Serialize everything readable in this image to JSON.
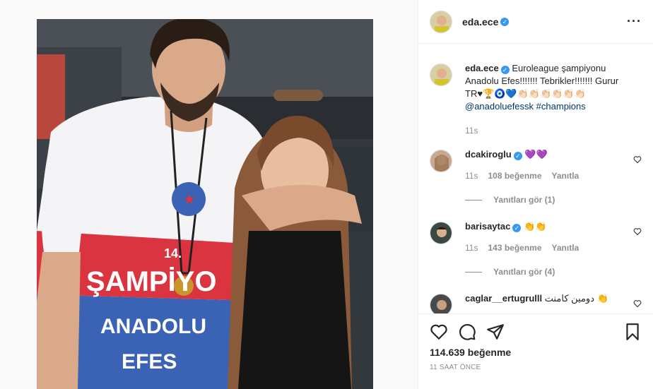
{
  "post": {
    "username": "eda.ece",
    "more_icon": "more-horizontal-icon"
  },
  "caption": {
    "username": "eda.ece",
    "text": "Euroleague şampiyonu Anadolu Efes!!!!!!! Tebrikler!!!!!!! Gurur",
    "emoji": "TR♥🏆🧿💙👏🏻👏🏻👏🏻👏🏻👏🏻👏🏻",
    "mention": "@anadoluefessk",
    "hashtag": "#champions",
    "time": "11s"
  },
  "comments": [
    {
      "username": "dcakiroglu",
      "text": "💜💜",
      "time": "11s",
      "likes": "108 beğenme",
      "reply_label": "Yanıtla",
      "view_replies": "Yanıtları gör (1)"
    },
    {
      "username": "barisaytac",
      "text": "👏👏",
      "time": "11s",
      "likes": "143 beğenme",
      "reply_label": "Yanıtla",
      "view_replies": "Yanıtları gör (4)"
    },
    {
      "username": "caglar__ertugrulll",
      "text": "دومين كامنت 👏"
    }
  ],
  "actions": {
    "like_icon": "heart-icon",
    "comment_icon": "comment-icon",
    "share_icon": "share-icon",
    "save_icon": "bookmark-icon",
    "likes_count": "114.639 beğenme",
    "timestamp": "11 SAAT ÖNCE"
  },
  "photo": {
    "jersey_number": "14.",
    "jersey_text_1": "ŞAMPİYO",
    "jersey_text_2": "ANADOLU",
    "jersey_text_3": "EFES"
  },
  "colors": {
    "verified": "#3897f0",
    "link": "#00376b",
    "jersey_red": "#d9343f",
    "jersey_blue": "#3b63b5"
  }
}
